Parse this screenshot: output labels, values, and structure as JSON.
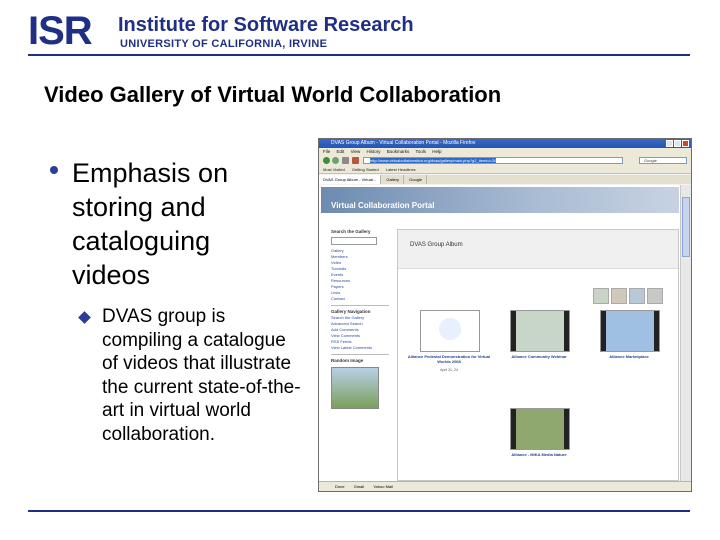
{
  "header": {
    "logo_short": "ISR",
    "institute": "Institute for Software Research",
    "university": "UNIVERSITY OF CALIFORNIA, IRVINE"
  },
  "slide": {
    "title": "Video Gallery of Virtual World Collaboration",
    "bullets": [
      {
        "text": "Emphasis on storing and cataloguing videos"
      },
      {
        "text": "DVAS group is compiling a catalogue of videos that illustrate the current state-of-the-art in virtual world collaboration."
      }
    ]
  },
  "browser": {
    "window_title": "DVAS Group Album - Virtual Collaboration Portal - Mozilla Firefox",
    "menu": [
      "File",
      "Edit",
      "View",
      "History",
      "Bookmarks",
      "Tools",
      "Help"
    ],
    "url": "http://www.virtualcollaboration.org/dvas/gallery/main.php?g2_itemId=20",
    "search_placeholder": "Google",
    "bookmarks": [
      "Most Visited",
      "Getting Started",
      "Latest Headlines"
    ],
    "tabs": [
      "DVAS Group Album - Virtual...",
      "Gallery",
      "Google"
    ],
    "status": [
      "Done",
      "Gmail",
      "Yahoo Mail"
    ],
    "portal_title": "Virtual Collaboration Portal",
    "sidebar": {
      "search_label": "Search the Gallery",
      "nav_label": "Gallery Navigation",
      "items": [
        "Gallery",
        "Members",
        "Video",
        "Tutorials",
        "Events",
        "Resources",
        "Papers",
        "Links",
        "Contact"
      ],
      "nav_items": [
        "Search the Gallery",
        "Advanced Search",
        "Add Comments",
        "View Comments",
        "RSS Feeds",
        "View Latest Comments"
      ],
      "random_label": "Random Image"
    },
    "album_title": "DVAS Group Album",
    "videos": [
      {
        "title": "Alliance Pedestal Demonstration for Virtual Worlds 2008",
        "date": "April 21, 24"
      },
      {
        "title": "Alliance Community Webinar",
        "date": ""
      },
      {
        "title": "Alliance Marketplace",
        "date": ""
      },
      {
        "title": "Alliance - MIKA Media Nature",
        "date": ""
      }
    ]
  }
}
